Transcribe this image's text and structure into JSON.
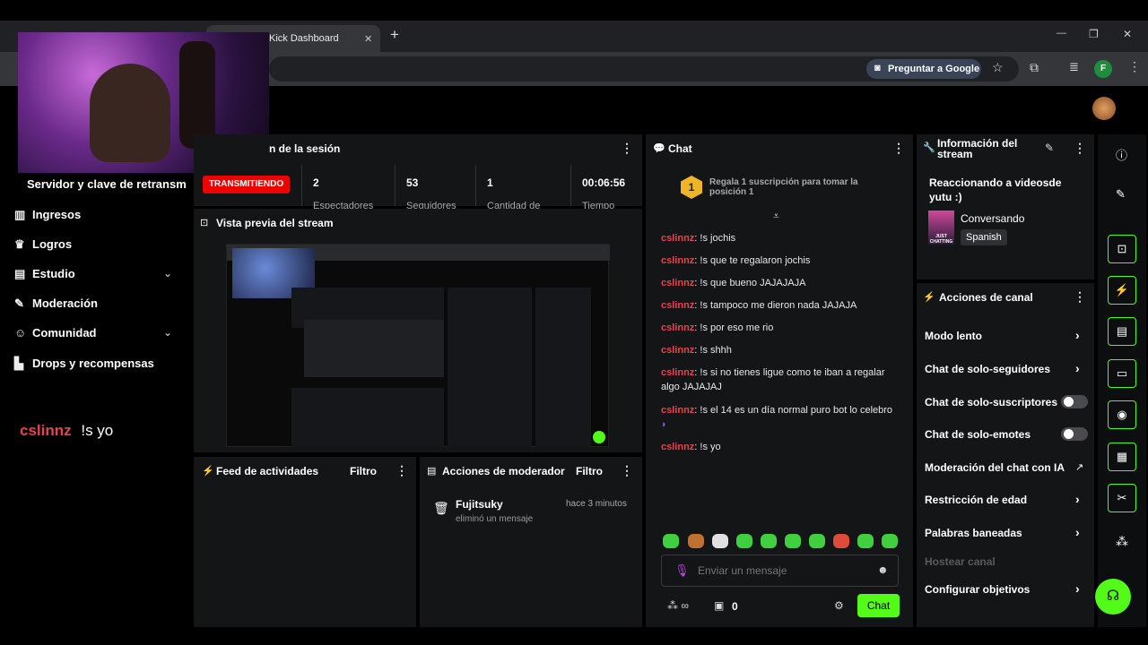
{
  "browser": {
    "tab_title": "Kick Dashboard",
    "new_tab": "+",
    "google_button": "Preguntar a Google",
    "profile_letter": "F",
    "window_minimize": "—",
    "window_restore": "❐",
    "window_close": "✕",
    "tab_close": "✕"
  },
  "session": {
    "title_fragment": "n de la sesión",
    "stream_key_label": "Servidor y clave de retransm",
    "status_badge": "TRANSMITIENDO",
    "stats": [
      {
        "value": "2",
        "label": "Espectadores"
      },
      {
        "value": "53",
        "label": "Seguidores"
      },
      {
        "value": "1",
        "label": "Cantidad de"
      },
      {
        "value": "00:06:56",
        "label": "Tiempo"
      }
    ]
  },
  "sidebar": {
    "items": [
      {
        "label": "Ingresos",
        "icon": "chart-icon"
      },
      {
        "label": "Logros",
        "icon": "trophy-icon"
      },
      {
        "label": "Estudio",
        "icon": "studio-icon"
      },
      {
        "label": "Moderación",
        "icon": "wrench-icon"
      },
      {
        "label": "Comunidad",
        "icon": "community-icon"
      },
      {
        "label": "Drops y recompensas",
        "icon": "drops-icon"
      }
    ]
  },
  "overlay_chat": {
    "user": "cslinnz",
    "text": "!s yo"
  },
  "preview": {
    "title": "Vista previa del stream"
  },
  "activity_feed": {
    "title": "Feed de actividades",
    "filter": "Filtro"
  },
  "mod_actions": {
    "title": "Acciones de moderador",
    "filter": "Filtro",
    "entry": {
      "user": "Fujitsuky",
      "action": "eliminó un mensaje",
      "time": "hace 3 minutos"
    }
  },
  "chat": {
    "title": "Chat",
    "pinned": "Regala 1 suscripción para tomar la posición 1",
    "pinned_rank": "1",
    "messages": [
      {
        "user": "cslinnz",
        "text": "!s jochis"
      },
      {
        "user": "cslinnz",
        "text": "!s que te regalaron jochis"
      },
      {
        "user": "cslinnz",
        "text": "!s que bueno JAJAJAJA"
      },
      {
        "user": "cslinnz",
        "text": "!s tampoco me dieron nada JAJAJA"
      },
      {
        "user": "cslinnz",
        "text": "!s por eso me rio"
      },
      {
        "user": "cslinnz",
        "text": "!s shhh"
      },
      {
        "user": "cslinnz",
        "text": "!s si no tienes ligue como te iban a regalar algo JAJAJAJ"
      },
      {
        "user": "cslinnz",
        "text": "!s el 14 es un día normal puro bot lo celebro"
      },
      {
        "user": "cslinnz",
        "text": "!s yo"
      }
    ],
    "input_placeholder": "Enviar un mensaje",
    "points": "0",
    "send_button": "Chat"
  },
  "stream_info": {
    "title": "Información del stream",
    "stream_title": "Reaccionando a videosde yutu :)",
    "category": "Conversando",
    "language": "Spanish",
    "thumb_text": "JUST CHATTING"
  },
  "channel_actions": {
    "title": "Acciones de canal",
    "items": [
      {
        "label": "Modo lento",
        "control": "chevron"
      },
      {
        "label": "Chat de solo-seguidores",
        "control": "chevron"
      },
      {
        "label": "Chat de solo-suscriptores",
        "control": "toggle"
      },
      {
        "label": "Chat de solo-emotes",
        "control": "toggle"
      },
      {
        "label": "Moderación del chat con IA",
        "control": "external"
      },
      {
        "label": "Restricción de edad",
        "control": "chevron"
      },
      {
        "label": "Palabras baneadas",
        "control": "chevron"
      },
      {
        "label": "Hostear canal",
        "control": "none"
      },
      {
        "label": "Configurar objetivos",
        "control": "chevron"
      }
    ]
  },
  "colors": {
    "accent": "#53fc18",
    "badge_red": "#eb0400",
    "username": "#e9424f",
    "panel": "#141517"
  }
}
